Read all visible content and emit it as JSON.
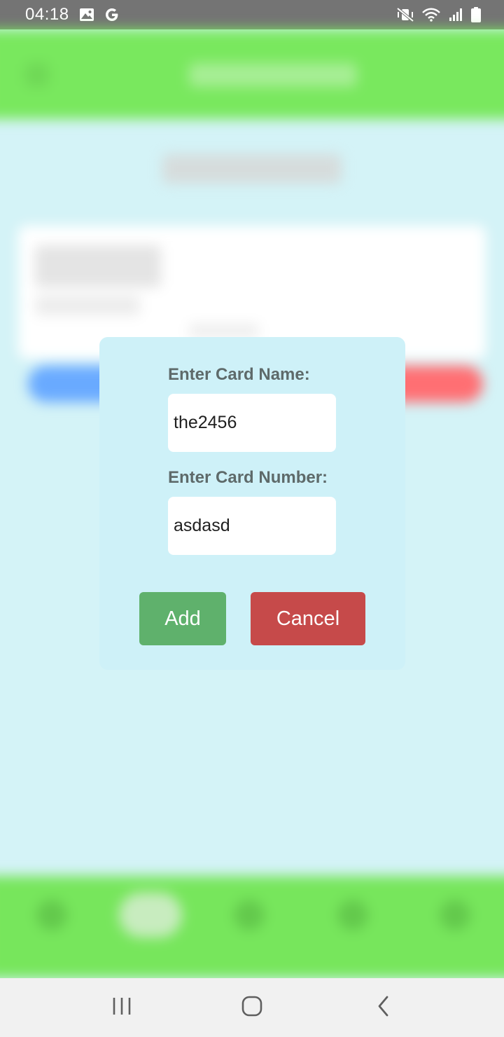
{
  "status_bar": {
    "time": "04:18",
    "left_icons": [
      "image-icon",
      "google-icon"
    ],
    "right_icons": [
      "mute-vibrate-icon",
      "wifi-icon",
      "signal-icon",
      "battery-icon"
    ]
  },
  "dialog": {
    "card_name_label": "Enter Card Name:",
    "card_name_value": "the2456",
    "card_number_label": "Enter Card Number:",
    "card_number_value": "asdasd",
    "add_label": "Add",
    "cancel_label": "Cancel"
  },
  "nav_bar": {
    "icons": [
      "recents-icon",
      "home-icon",
      "back-icon"
    ]
  },
  "colors": {
    "header_green": "#79e85e",
    "background": "#d4f3f7",
    "dialog_bg": "#cef1f8",
    "add_button": "#5fb16c",
    "cancel_button": "#c64a4a",
    "label_text": "#5e6a6a"
  }
}
